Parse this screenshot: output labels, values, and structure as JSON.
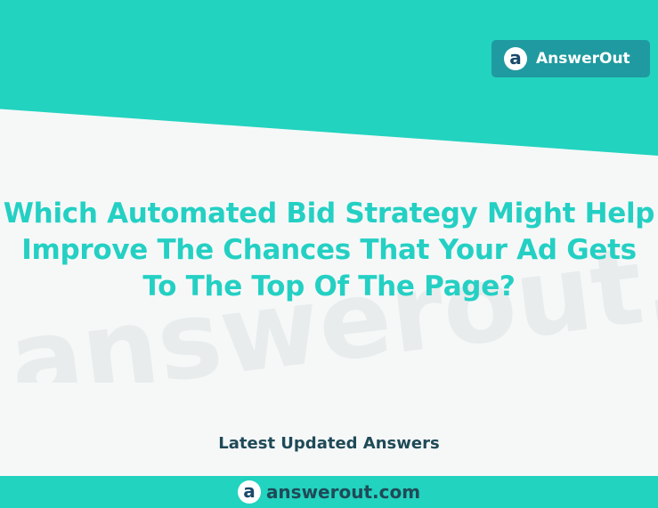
{
  "header": {
    "brand_name": "AnswerOut",
    "logo_glyph": "a",
    "accent_color": "#22d3bf",
    "badge_color": "#1f9aa0"
  },
  "watermark": {
    "text": "answerout.com"
  },
  "main": {
    "headline_lines": [
      "Which Automated Bid Strategy Might Help",
      "Improve The Chances That Your Ad Gets",
      "To The Top Of The Page?"
    ],
    "headline_color": "#24d0c3"
  },
  "section": {
    "label": "Latest Updated Answers"
  },
  "footer": {
    "logo_glyph": "a",
    "site": "answerout.com"
  }
}
